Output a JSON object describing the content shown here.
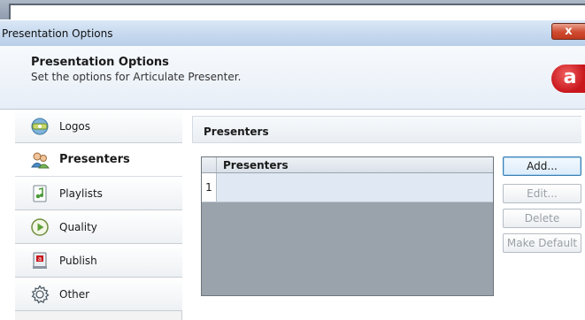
{
  "window": {
    "title": "Presentation Options",
    "close_glyph": "x"
  },
  "header": {
    "title": "Presentation Options",
    "subtitle": "Set the options for Articulate Presenter.",
    "logo_glyph": "a",
    "logo_color": "#c8161b"
  },
  "sidebar": {
    "items": [
      {
        "label": "Logos",
        "icon": "logos-icon"
      },
      {
        "label": "Presenters",
        "icon": "presenters-icon",
        "active": true
      },
      {
        "label": "Playlists",
        "icon": "playlists-icon"
      },
      {
        "label": "Quality",
        "icon": "quality-icon"
      },
      {
        "label": "Publish",
        "icon": "publish-icon"
      },
      {
        "label": "Other",
        "icon": "gear-icon"
      }
    ]
  },
  "main": {
    "section_title": "Presenters",
    "grid": {
      "column_header": "Presenters",
      "rows": [
        {
          "number": "1",
          "value": ""
        }
      ]
    },
    "buttons": {
      "add": "Add...",
      "edit": "Edit...",
      "delete": "Delete",
      "make_default": "Make Default"
    }
  }
}
